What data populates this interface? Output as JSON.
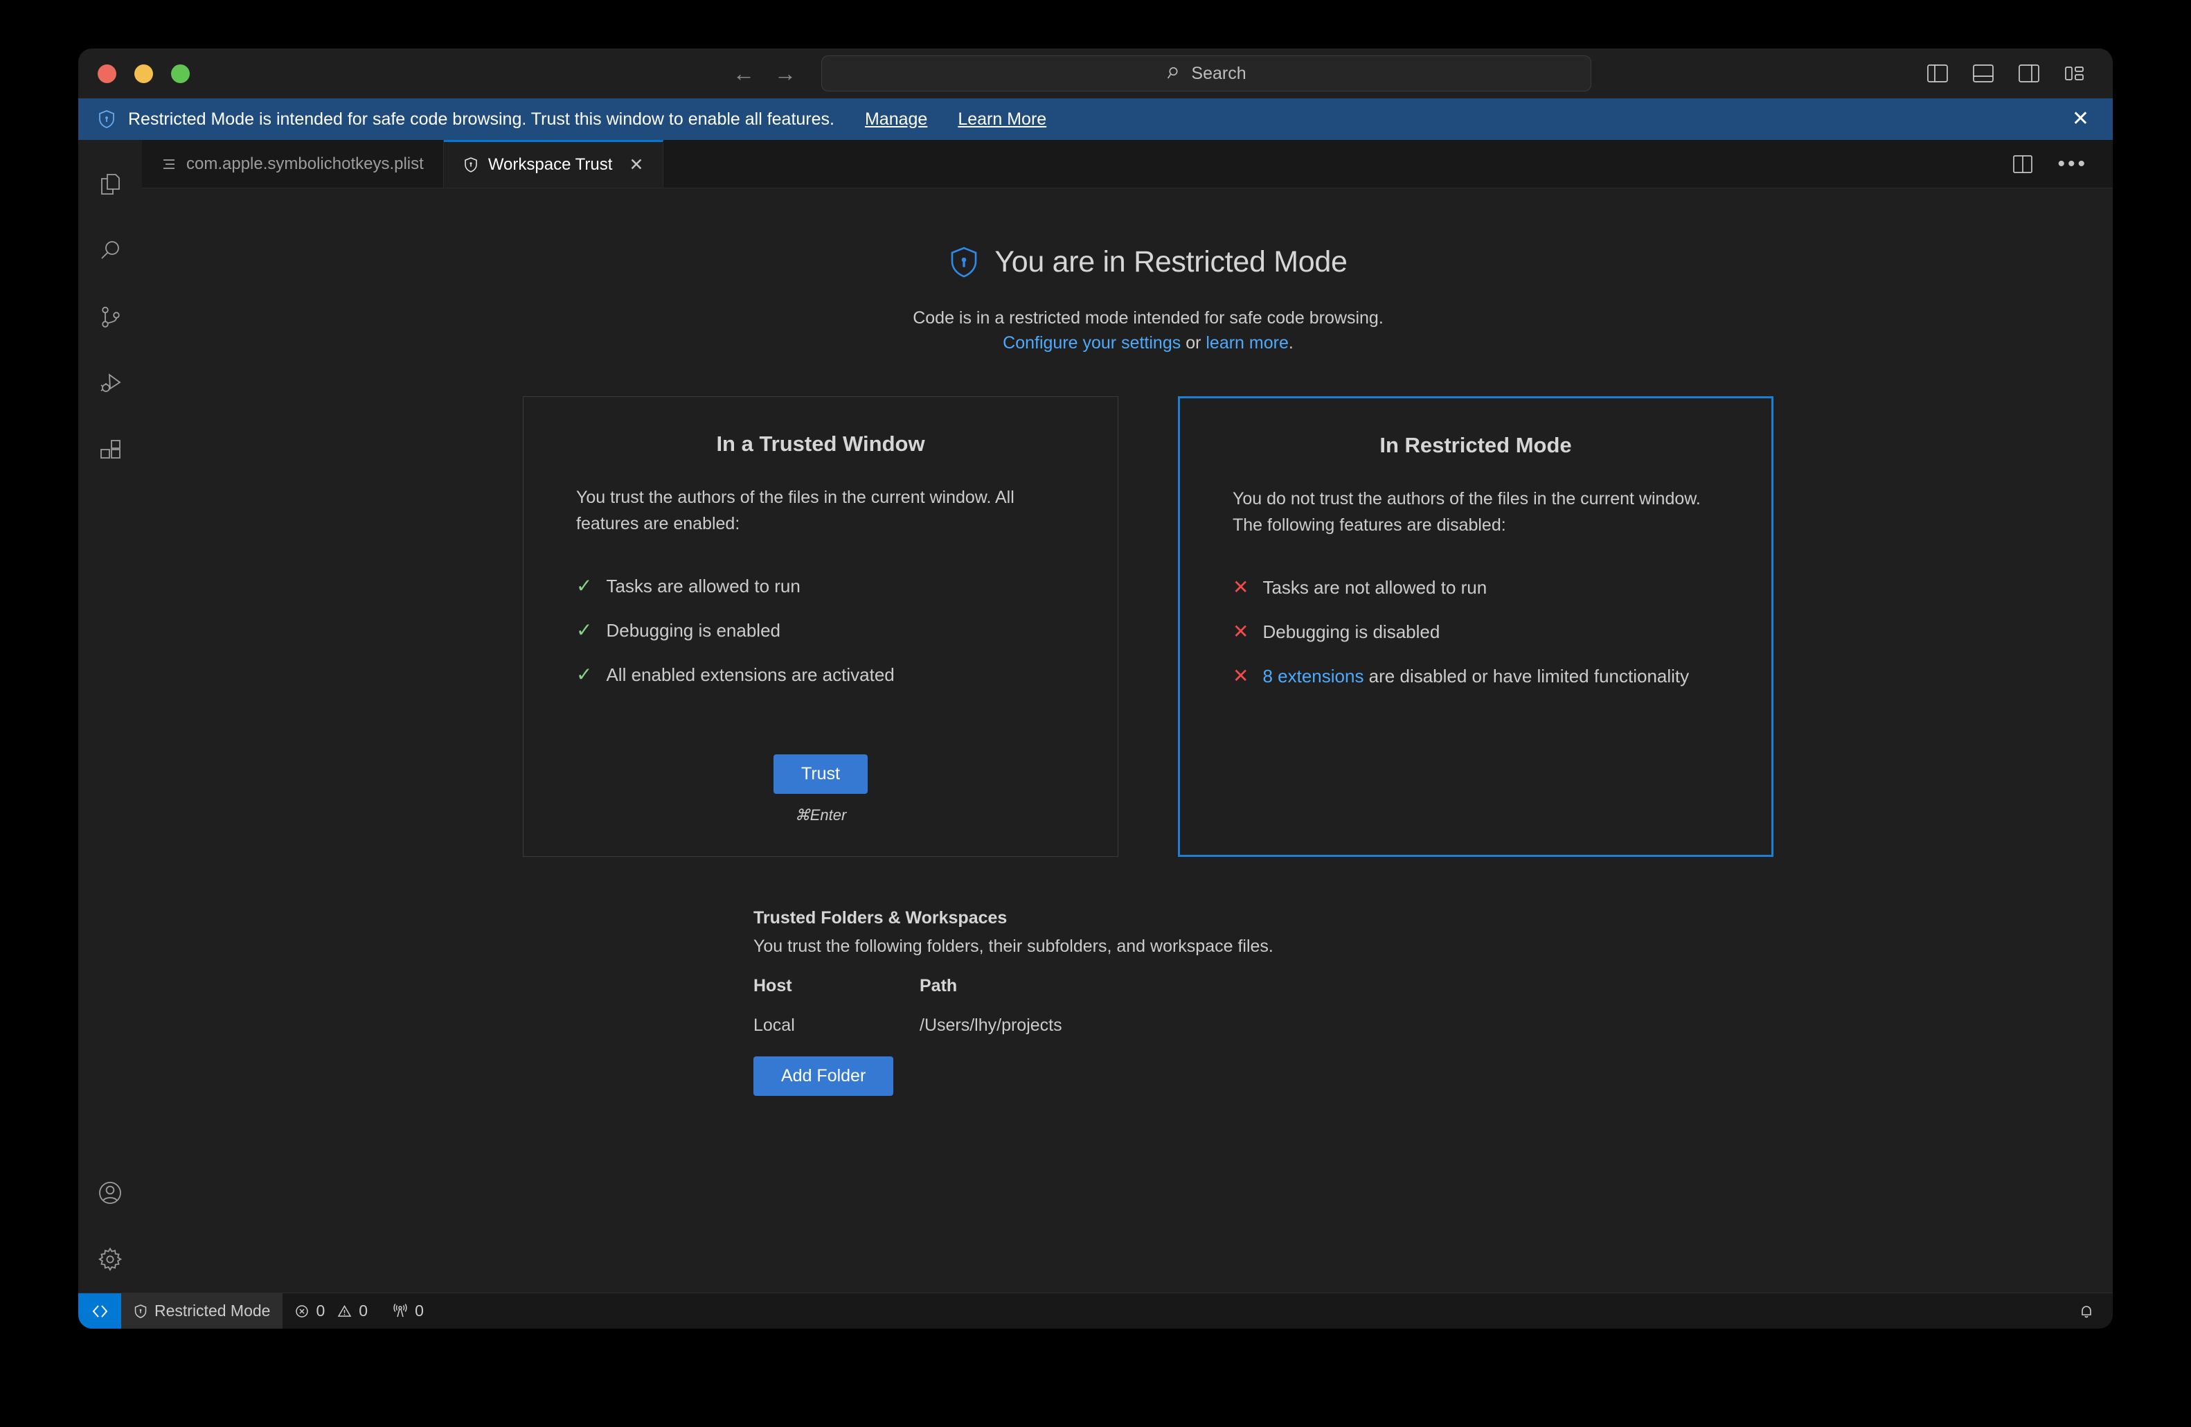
{
  "window": {
    "traffic_lights": [
      "close",
      "minimize",
      "maximize"
    ],
    "search_placeholder": "Search",
    "search_value": ""
  },
  "banner": {
    "icon": "shield-icon",
    "message": "Restricted Mode is intended for safe code browsing. Trust this window to enable all features.",
    "manage_label": "Manage",
    "learn_more_label": "Learn More",
    "close_label": "✕",
    "background": "#1f4b7d"
  },
  "activitybar": {
    "items": [
      {
        "name": "explorer",
        "icon": "files-icon"
      },
      {
        "name": "search",
        "icon": "search-icon"
      },
      {
        "name": "source-control",
        "icon": "source-control-icon"
      },
      {
        "name": "run-and-debug",
        "icon": "run-debug-icon"
      },
      {
        "name": "extensions",
        "icon": "extensions-icon"
      }
    ],
    "bottom_items": [
      {
        "name": "accounts",
        "icon": "account-icon"
      },
      {
        "name": "manage",
        "icon": "gear-icon"
      }
    ]
  },
  "tabs": [
    {
      "label": "com.apple.symbolichotkeys.plist",
      "icon": "plist-icon",
      "active": false,
      "closable": false
    },
    {
      "label": "Workspace Trust",
      "icon": "shield-icon",
      "active": true,
      "closable": true,
      "close_label": "✕"
    }
  ],
  "editor_actions": {
    "split_editor": "split-editor-icon",
    "more_actions": "•••"
  },
  "titlebar_actions": [
    "toggle-primary-sidebar-icon",
    "toggle-panel-icon",
    "toggle-secondary-sidebar-icon",
    "customize-layout-icon"
  ],
  "trust_page": {
    "heading": "You are in Restricted Mode",
    "heading_icon": "shield-lock-icon",
    "subtitle_line1": "Code is in a restricted mode intended for safe code browsing.",
    "subtitle_link1": "Configure your settings",
    "subtitle_or": " or ",
    "subtitle_link2": "learn more",
    "subtitle_period": ".",
    "cards": [
      {
        "id": "trusted-window",
        "title": "In a Trusted Window",
        "description": "You trust the authors of the files in the current window. All features are enabled:",
        "selected": false,
        "features": [
          {
            "mark": "✓",
            "status": "ok",
            "text": "Tasks are allowed to run"
          },
          {
            "mark": "✓",
            "status": "ok",
            "text": "Debugging is enabled"
          },
          {
            "mark": "✓",
            "status": "ok",
            "text": "All enabled extensions are activated"
          }
        ],
        "button_label": "Trust",
        "shortcut": "⌘Enter"
      },
      {
        "id": "restricted-mode",
        "title": "In Restricted Mode",
        "description": "You do not trust the authors of the files in the current window. The following features are disabled:",
        "selected": true,
        "features": [
          {
            "mark": "✕",
            "status": "no",
            "text": "Tasks are not allowed to run"
          },
          {
            "mark": "✕",
            "status": "no",
            "text": "Debugging is disabled"
          },
          {
            "mark": "✕",
            "status": "no",
            "link": "8 extensions",
            "text": " are disabled or have limited functionality"
          }
        ]
      }
    ],
    "trusted_folders": {
      "heading": "Trusted Folders & Workspaces",
      "description": "You trust the following folders, their subfolders, and workspace files.",
      "columns": [
        "Host",
        "Path"
      ],
      "rows": [
        {
          "host": "Local",
          "path": "/Users/lhy/projects"
        }
      ],
      "add_button_label": "Add Folder"
    }
  },
  "statusbar": {
    "remote_icon": "remote-window-icon",
    "trust_label": "Restricted Mode",
    "trust_icon": "shield-icon",
    "errors_icon": "error-icon",
    "errors_count": "0",
    "warnings_icon": "warning-icon",
    "warnings_count": "0",
    "ports_icon": "radio-tower-icon",
    "ports_count": "0",
    "bell_icon": "bell-icon"
  },
  "colors": {
    "accent_blue": "#0078d4",
    "button_blue": "#3579d2",
    "link_blue": "#4daafc",
    "banner_blue": "#1f4b7d",
    "success_green": "#89d185",
    "error_red": "#f14c4c",
    "editor_bg": "#1f1f1f",
    "tabbar_bg": "#181818"
  }
}
